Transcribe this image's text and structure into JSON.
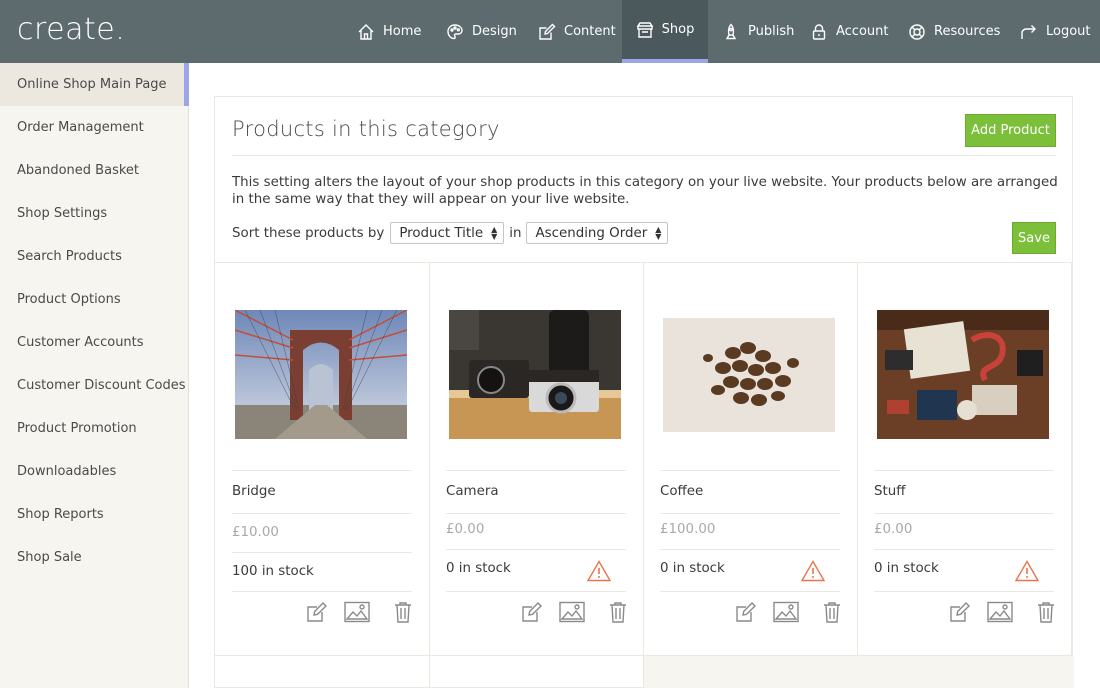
{
  "app": {
    "logo": "create."
  },
  "nav": [
    {
      "label": "Home",
      "icon": "home-icon"
    },
    {
      "label": "Design",
      "icon": "palette-icon"
    },
    {
      "label": "Content",
      "icon": "edit-icon"
    },
    {
      "label": "Shop",
      "icon": "shop-icon",
      "active": true
    },
    {
      "label": "Publish",
      "icon": "rocket-icon"
    },
    {
      "label": "Account",
      "icon": "lock-icon"
    },
    {
      "label": "Resources",
      "icon": "lifebuoy-icon"
    },
    {
      "label": "Logout",
      "icon": "logout-icon"
    }
  ],
  "sidebar": {
    "items": [
      {
        "label": "Online Shop Main Page",
        "active": true
      },
      {
        "label": "Order Management"
      },
      {
        "label": "Abandoned Basket"
      },
      {
        "label": "Shop Settings"
      },
      {
        "label": "Search Products"
      },
      {
        "label": "Product Options"
      },
      {
        "label": "Customer Accounts"
      },
      {
        "label": "Customer Discount Codes"
      },
      {
        "label": "Product Promotion"
      },
      {
        "label": "Downloadables"
      },
      {
        "label": "Shop Reports"
      },
      {
        "label": "Shop Sale"
      }
    ]
  },
  "main": {
    "title": "Products in this category",
    "add_button": "Add Product",
    "save_button": "Save",
    "description": "This setting alters the layout of your shop products in this category on your live website. Your products below are arranged in the same way that they will appear on your live website.",
    "sort": {
      "prefix": "Sort these products by",
      "field": "Product Title",
      "joiner": "in",
      "order": "Ascending Order"
    }
  },
  "products": [
    {
      "name": "Bridge",
      "price": "£10.00",
      "stock": "100 in stock",
      "warning": false
    },
    {
      "name": "Camera",
      "price": "£0.00",
      "stock": "0 in stock",
      "warning": true
    },
    {
      "name": "Coffee",
      "price": "£100.00",
      "stock": "0 in stock",
      "warning": true
    },
    {
      "name": "Stuff",
      "price": "£0.00",
      "stock": "0 in stock",
      "warning": true
    }
  ],
  "colors": {
    "topbar": "#5d6b6f",
    "accent": "#9aa6e8",
    "button_green": "#7cbf3a",
    "warning": "#e8744a"
  }
}
